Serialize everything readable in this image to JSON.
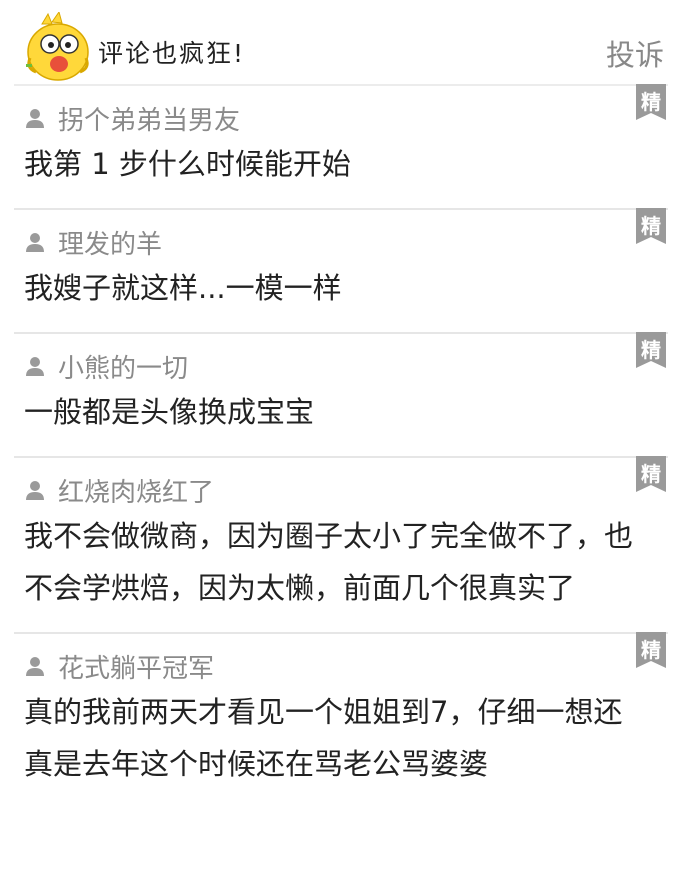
{
  "header": {
    "title": "评论也疯狂!",
    "report_label": "投诉"
  },
  "comments": [
    {
      "username": "拐个弟弟当男友",
      "text": "我第 1 步什么时候能开始",
      "badge": "精"
    },
    {
      "username": "理发的羊",
      "text": "我嫂子就这样...一模一样",
      "badge": "精"
    },
    {
      "username": "小熊的一切",
      "text": "一般都是头像换成宝宝",
      "badge": "精"
    },
    {
      "username": "红烧肉烧红了",
      "text": "我不会做微商，因为圈子太小了完全做不了，也不会学烘焙，因为太懒，前面几个很真实了",
      "badge": "精"
    },
    {
      "username": "花式躺平冠军",
      "text": "真的我前两天才看见一个姐姐到7，仔细一想还真是去年这个时候还在骂老公骂婆婆",
      "badge": "精"
    }
  ]
}
